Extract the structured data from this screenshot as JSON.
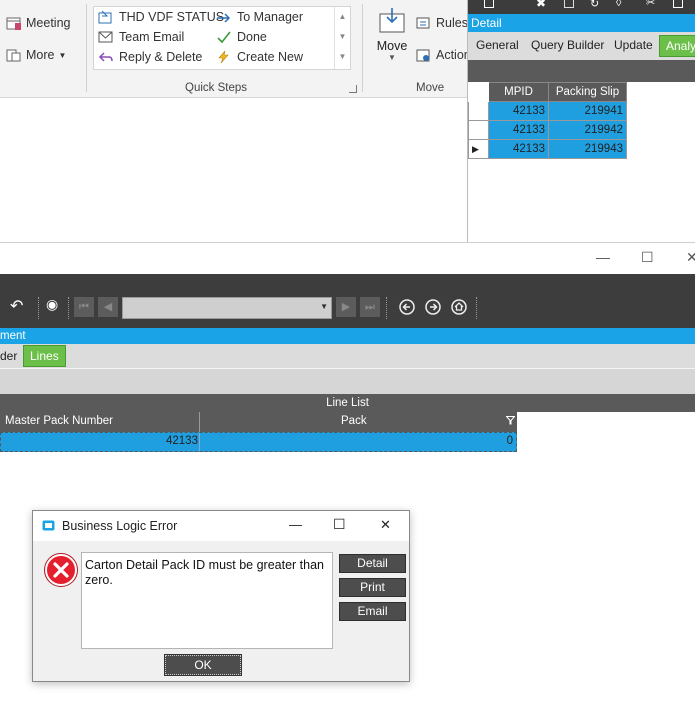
{
  "ribbon": {
    "meeting_label": "Meeting",
    "more_label": "More",
    "quick_steps": [
      {
        "label": "THD VDF STATUS",
        "icon": "move-to-folder-icon"
      },
      {
        "label": "To Manager",
        "icon": "forward-arrow-icon"
      },
      {
        "label": "Team Email",
        "icon": "envelope-icon"
      },
      {
        "label": "Done",
        "icon": "checkmark-icon"
      },
      {
        "label": "Reply & Delete",
        "icon": "reply-icon"
      },
      {
        "label": "Create New",
        "icon": "lightning-icon"
      }
    ],
    "quick_steps_group": "Quick Steps",
    "move_label": "Move",
    "rules_label": "Rules",
    "actions_label": "Action",
    "move_group": "Move"
  },
  "detail_window": {
    "title": "Detail",
    "tabs": [
      "General",
      "Query Builder",
      "Update"
    ],
    "active_tab": "Analyz",
    "columns": [
      "MPID",
      "Packing Slip"
    ],
    "rows": [
      {
        "mpid": "42133",
        "packing_slip": "219941"
      },
      {
        "mpid": "42133",
        "packing_slip": "219942"
      },
      {
        "mpid": "42133",
        "packing_slip": "219943"
      }
    ]
  },
  "main_window": {
    "window_controls": {
      "minimize": "—",
      "maximize": "☐",
      "close": "✕"
    },
    "title": "ment",
    "tab_partial": "der",
    "tab_active": "Lines",
    "line_list_title": "Line List",
    "columns": [
      "Master Pack Number",
      "Pack"
    ],
    "row": {
      "master_pack_number": "42133",
      "pack": "0"
    }
  },
  "dialog": {
    "title": "Business Logic Error",
    "message": "Carton Detail Pack ID must be greater than zero.",
    "buttons": [
      "Detail",
      "Print",
      "Email"
    ],
    "ok_label": "OK",
    "controls": {
      "minimize": "—",
      "maximize": "☐",
      "close": "✕"
    }
  },
  "colors": {
    "accent_blue": "#1aa3e6",
    "selection_blue": "#1f9fe0",
    "active_tab_green": "#6cc04a",
    "dark_toolbar": "#3d3d3d",
    "error_red": "#e5202e"
  }
}
